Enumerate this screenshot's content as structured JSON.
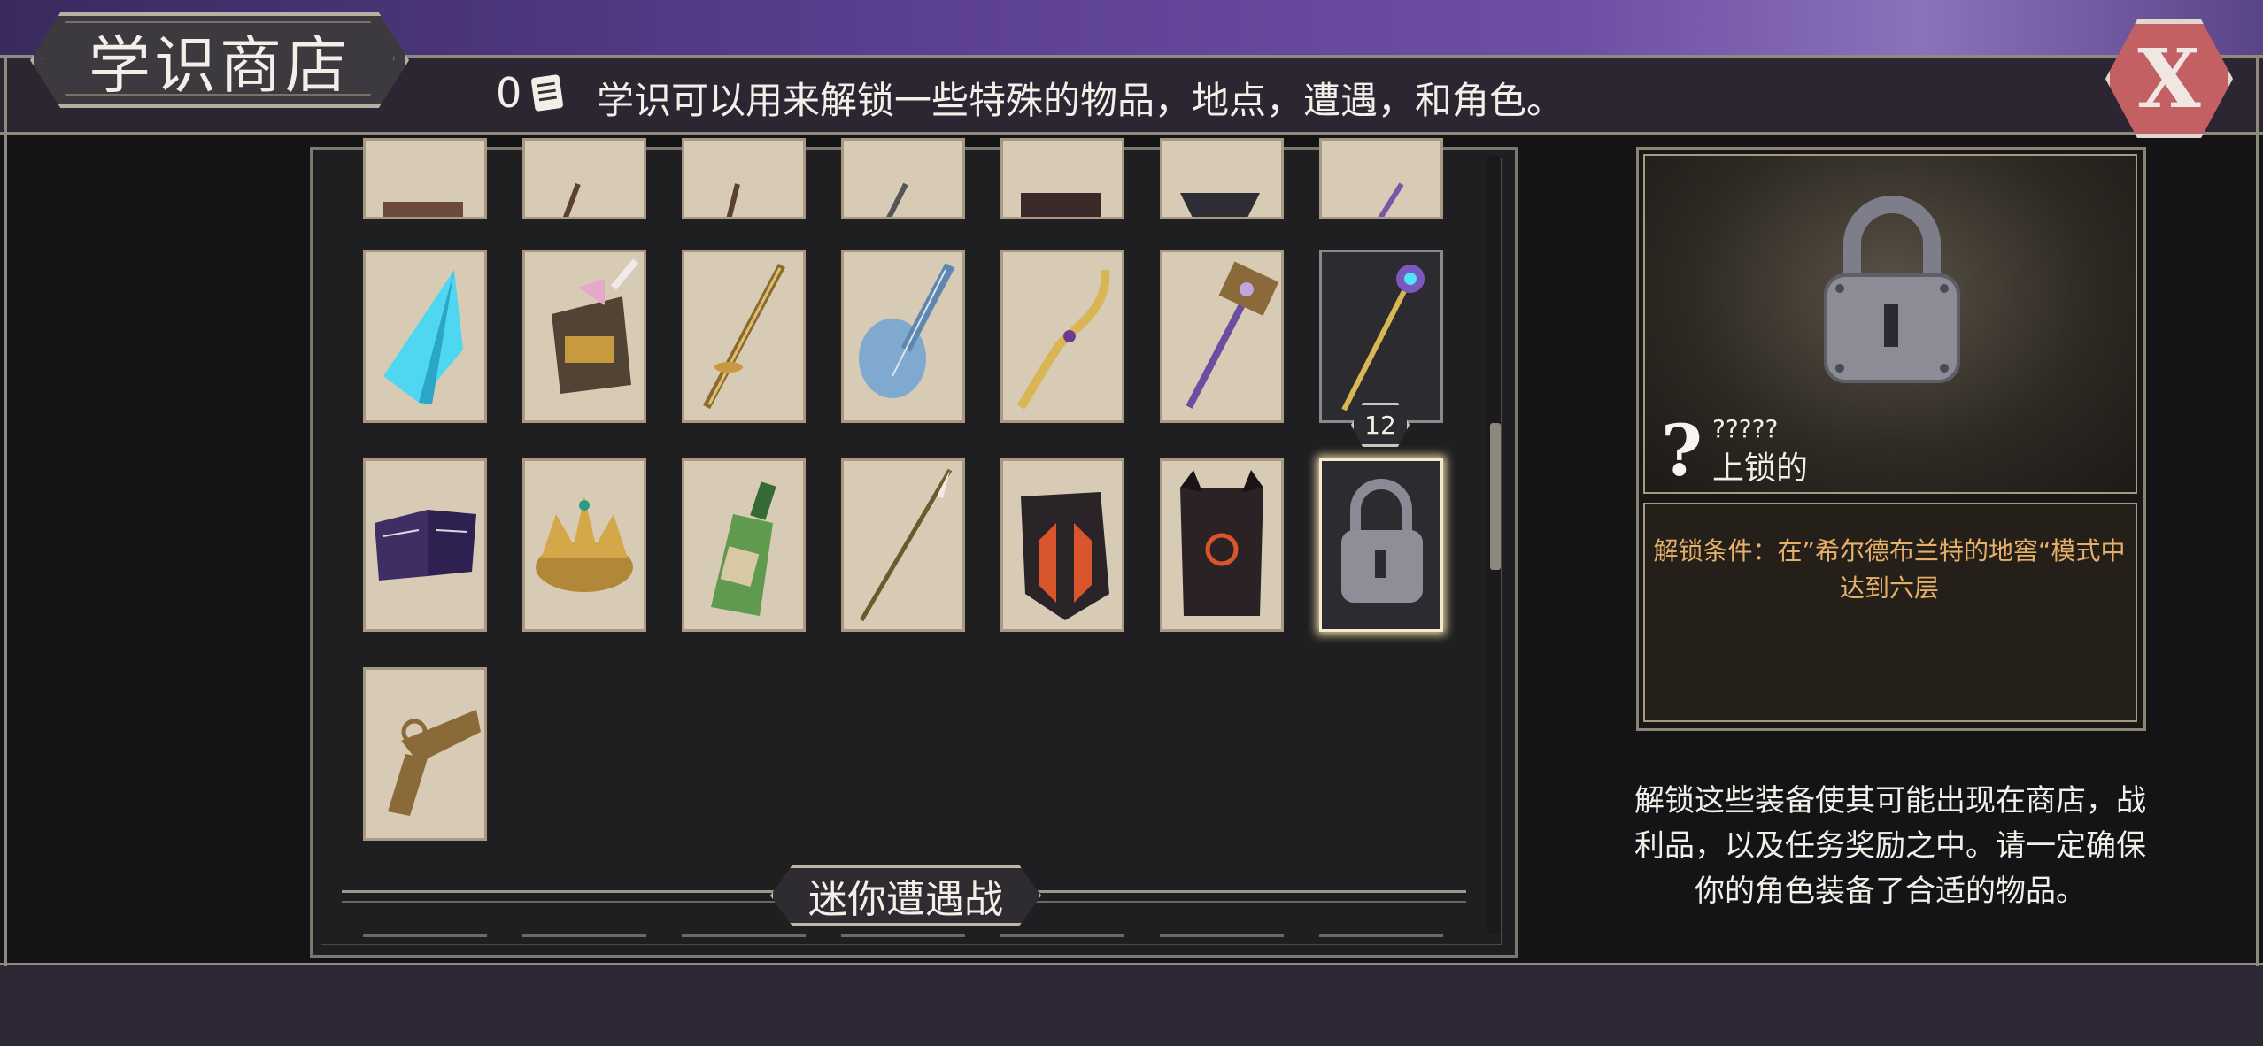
{
  "header": {
    "title": "学识商店",
    "lore_count": "0",
    "lore_description": "学识可以用来解锁一些特殊的物品，地点，遭遇，和角色。",
    "close_label": "X"
  },
  "grid": {
    "section_label": "迷你遭遇战",
    "price_badge": "12",
    "rows": [
      [
        "cut-off-item-icon",
        "cut-off-item-icon",
        "cut-off-item-icon",
        "cut-off-item-icon",
        "cut-off-item-icon",
        "cut-off-item-icon",
        "cut-off-item-icon"
      ],
      [
        "crystal-drill-icon",
        "unicorn-helmet-icon",
        "golden-sword-icon",
        "blue-lute-icon",
        "golden-bow-icon",
        "war-hammer-icon",
        "crystal-scepter-icon"
      ],
      [
        "spell-book-icon",
        "jeweled-crown-icon",
        "bottle-icon",
        "spear-icon",
        "dark-helmet-icon",
        "demon-armor-icon",
        "padlock-icon"
      ],
      [
        "flintlock-pistol-icon"
      ]
    ]
  },
  "detail": {
    "item_name": "?????",
    "status": "上锁的",
    "unlock_condition": "解锁条件：在”希尔德布兰特的地窖“模式中达到六层",
    "accent_color": "#e6b06a"
  },
  "info_text": "解锁这些装备使其可能出现在商店，战利品，以及任务奖励之中。请一定确保你的角色装备了合适的物品。"
}
